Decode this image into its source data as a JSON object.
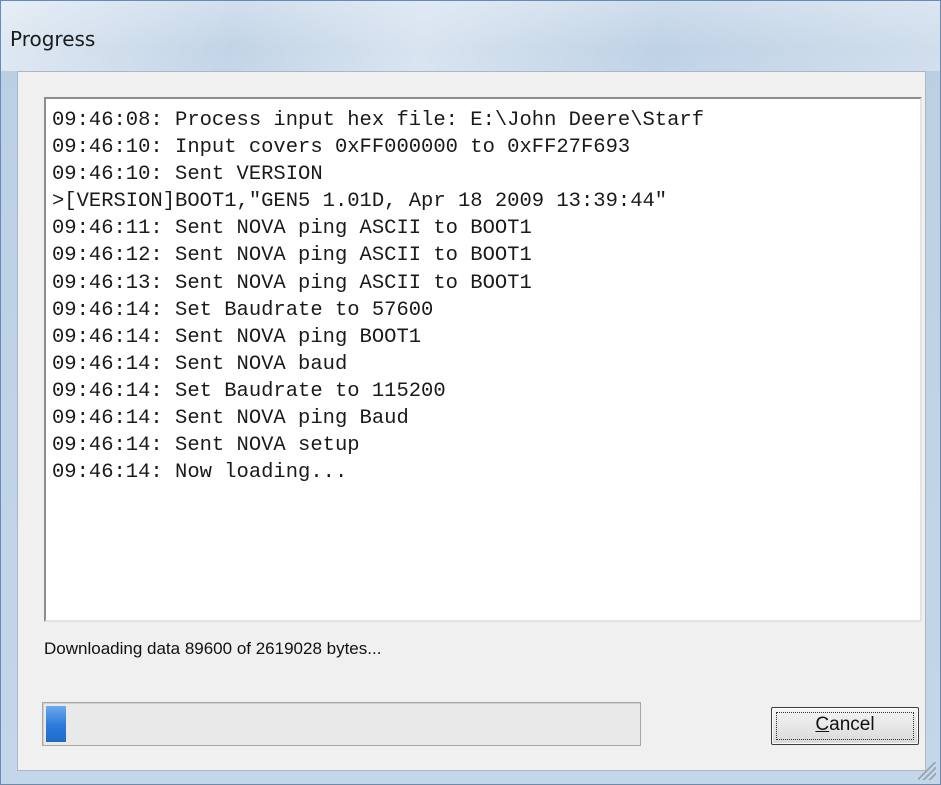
{
  "window": {
    "title": "Progress"
  },
  "log": {
    "lines": [
      "09:46:08: Process input hex file: E:\\John Deere\\Starf",
      "09:46:10: Input covers 0xFF000000 to 0xFF27F693",
      "09:46:10: Sent VERSION",
      ">[VERSION]BOOT1,\"GEN5 1.01D, Apr 18 2009 13:39:44\"",
      "09:46:11: Sent NOVA ping ASCII to BOOT1",
      "09:46:12: Sent NOVA ping ASCII to BOOT1",
      "09:46:13: Sent NOVA ping ASCII to BOOT1",
      "09:46:14: Set Baudrate to 57600",
      "09:46:14: Sent NOVA ping BOOT1",
      "09:46:14: Sent NOVA baud",
      "09:46:14: Set Baudrate to 115200",
      "09:46:14: Sent NOVA ping Baud",
      "09:46:14: Sent NOVA setup",
      "09:46:14: Now loading..."
    ]
  },
  "status": {
    "text": "Downloading data 89600 of 2619028 bytes..."
  },
  "progress": {
    "value": 0.034
  },
  "buttons": {
    "cancel_mnemonic": "C",
    "cancel_rest": "ancel"
  },
  "icons": {
    "resize": "resize-grip-icon"
  }
}
